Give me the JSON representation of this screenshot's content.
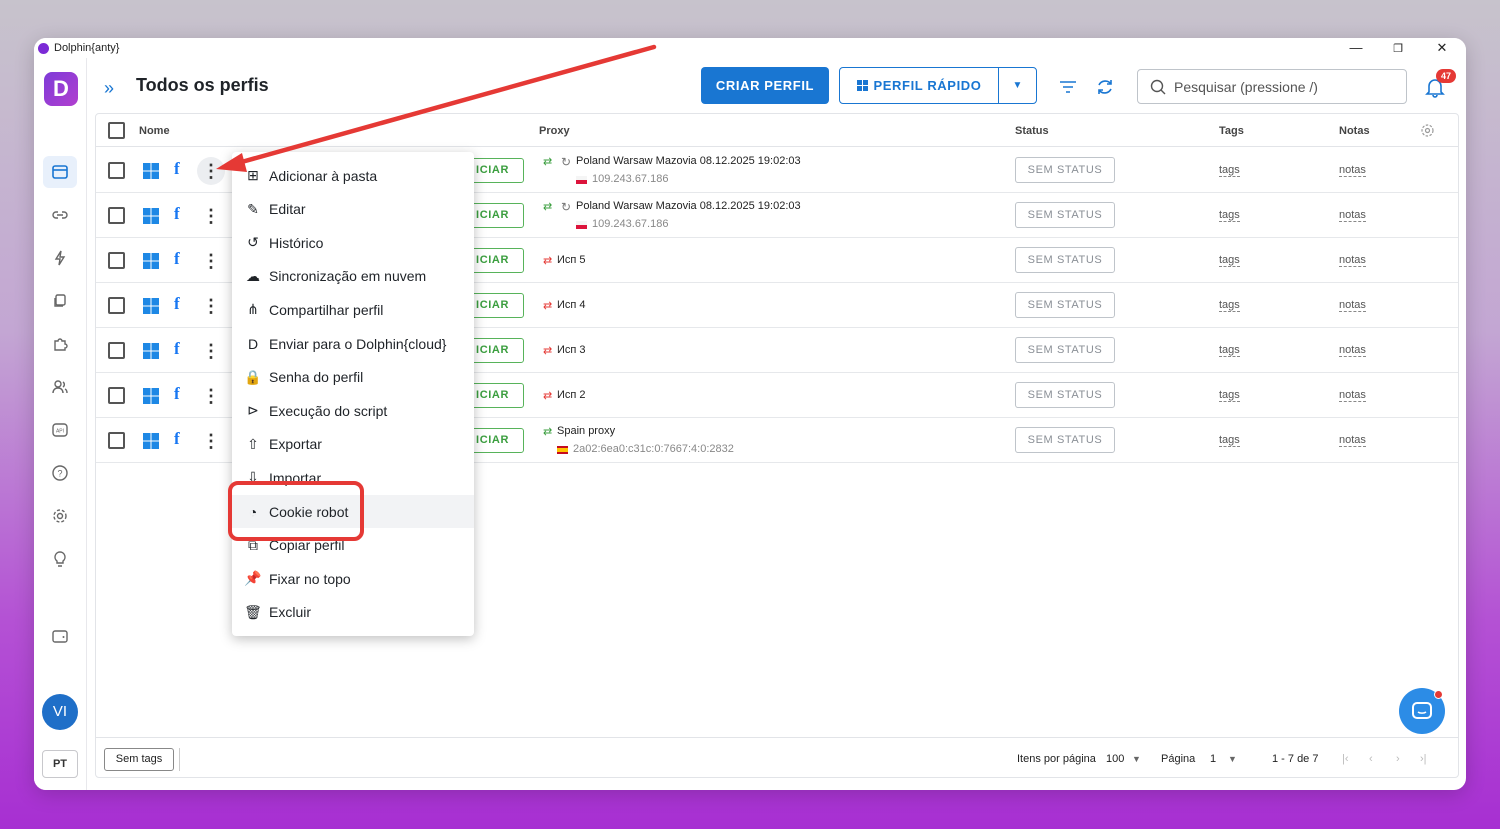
{
  "window": {
    "title": "Dolphin{anty}",
    "minimize": "—",
    "maximize": "❐",
    "close": "✕"
  },
  "rail": {
    "avatar": "VI",
    "language": "PT"
  },
  "header": {
    "title": "Todos os perfis",
    "create_button": "CRIAR PERFIL",
    "quick_button": "PERFIL RÁPIDO",
    "search_placeholder": "Pesquisar (pressione /)",
    "notification_count": "47"
  },
  "table": {
    "columns": {
      "name": "Nome",
      "proxy": "Proxy",
      "status": "Status",
      "tags": "Tags",
      "notes": "Notas"
    },
    "rows": [
      {
        "start": "ICIAR",
        "proxy_name": "Poland Warsaw Mazovia 08.12.2025 19:02:03",
        "proxy_ip": "109.243.67.186",
        "status": "SEM STATUS",
        "tags": "tags",
        "notes": "notas"
      },
      {
        "start": "ICIAR",
        "proxy_name": "Poland Warsaw Mazovia 08.12.2025 19:02:03",
        "proxy_ip": "109.243.67.186",
        "status": "SEM STATUS",
        "tags": "tags",
        "notes": "notas"
      },
      {
        "start": "ICIAR",
        "proxy_name": "Исп 5",
        "proxy_ip": "",
        "status": "SEM STATUS",
        "tags": "tags",
        "notes": "notas"
      },
      {
        "start": "ICIAR",
        "proxy_name": "Исп 4",
        "proxy_ip": "",
        "status": "SEM STATUS",
        "tags": "tags",
        "notes": "notas"
      },
      {
        "start": "ICIAR",
        "proxy_name": "Исп 3",
        "proxy_ip": "",
        "status": "SEM STATUS",
        "tags": "tags",
        "notes": "notas"
      },
      {
        "start": "ICIAR",
        "proxy_name": "Исп 2",
        "proxy_ip": "",
        "status": "SEM STATUS",
        "tags": "tags",
        "notes": "notas"
      },
      {
        "start": "ICIAR",
        "proxy_name": "Spain proxy",
        "proxy_ip": "2a02:6ea0:c31c:0:7667:4:0:2832",
        "status": "SEM STATUS",
        "tags": "tags",
        "notes": "notas"
      }
    ]
  },
  "footer": {
    "tag_chip": "Sem tags",
    "items_per_page_label": "Itens por página",
    "items_per_page": "100",
    "page_label": "Página",
    "page": "1",
    "range": "1 - 7 de 7"
  },
  "context_menu": {
    "items": [
      "Adicionar à pasta",
      "Editar",
      "Histórico",
      "Sincronização em nuvem",
      "Compartilhar perfil",
      "Enviar para o Dolphin{cloud}",
      "Senha do perfil",
      "Execução do script",
      "Exportar",
      "Importar",
      "Cookie robot",
      "Copiar perfil",
      "Fixar no topo",
      "Excluir"
    ]
  },
  "colors": {
    "accent": "#1976d2",
    "start_green": "#3a9e3e",
    "annotation_red": "#e53935"
  }
}
